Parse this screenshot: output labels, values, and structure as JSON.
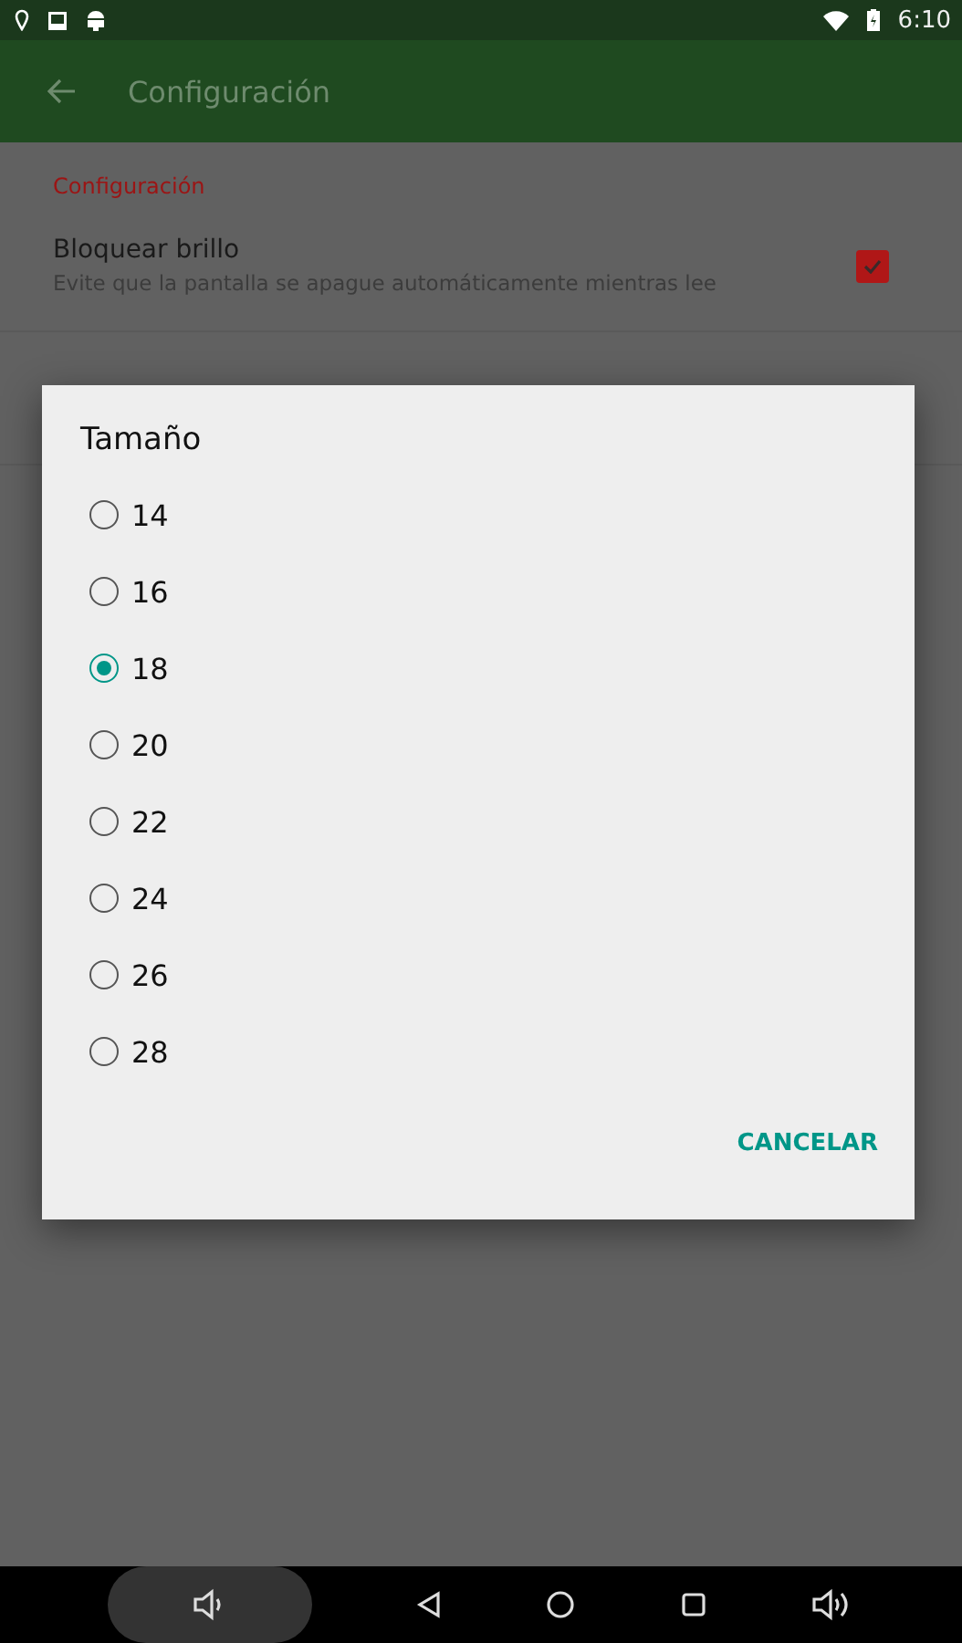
{
  "status_bar": {
    "time": "6:10"
  },
  "app_bar": {
    "title": "Configuración"
  },
  "settings": {
    "section": "Configuración",
    "items": [
      {
        "kind": "checkbox",
        "title": "Bloquear brillo",
        "summary": "Evite que la pantalla se apague automáticamente mientras lee",
        "checked": true
      }
    ]
  },
  "dialog": {
    "title": "Tamaño",
    "options": [
      {
        "label": "14",
        "selected": false
      },
      {
        "label": "16",
        "selected": false
      },
      {
        "label": "18",
        "selected": true
      },
      {
        "label": "20",
        "selected": false
      },
      {
        "label": "22",
        "selected": false
      },
      {
        "label": "24",
        "selected": false
      },
      {
        "label": "26",
        "selected": false
      },
      {
        "label": "28",
        "selected": false
      }
    ],
    "buttons": [
      "CANCELAR"
    ]
  }
}
